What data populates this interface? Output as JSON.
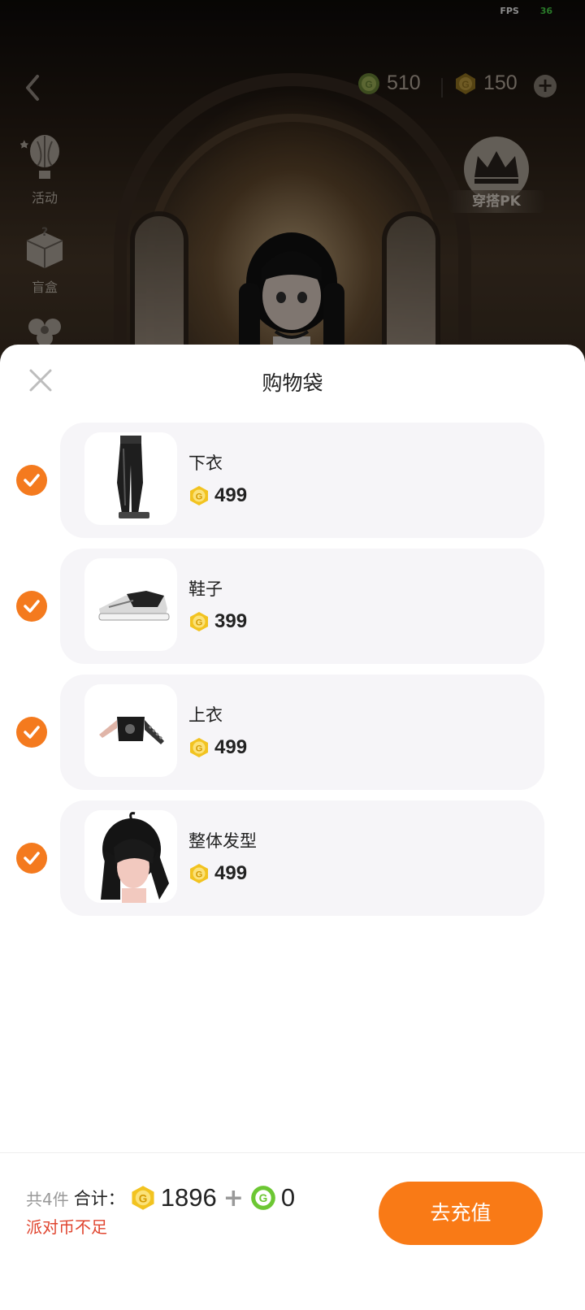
{
  "status_bar": {
    "fps_label": "FPS",
    "fps_value": "36"
  },
  "header": {
    "currency_green_value": "510",
    "currency_gold_value": "150"
  },
  "sidebar": {
    "items": [
      {
        "label": "活动",
        "icon": "hot-air-balloon-icon"
      },
      {
        "label": "盲盒",
        "icon": "mystery-box-icon"
      },
      {
        "label": "",
        "icon": "flower-icon"
      }
    ]
  },
  "pk_badge": {
    "label": "穿搭PK",
    "icon": "crown-icon"
  },
  "sheet": {
    "title": "购物袋",
    "items": [
      {
        "name": "下衣",
        "price": "499",
        "checked": true,
        "icon": "pants-icon"
      },
      {
        "name": "鞋子",
        "price": "399",
        "checked": true,
        "icon": "sneaker-icon"
      },
      {
        "name": "上衣",
        "price": "499",
        "checked": true,
        "icon": "top-icon"
      },
      {
        "name": "整体发型",
        "price": "499",
        "checked": true,
        "icon": "hairstyle-icon"
      }
    ]
  },
  "footer": {
    "count": "共4件",
    "total_label": "合计：",
    "gold_total": "1896",
    "plus": "+",
    "green_total": "0",
    "warning": "派对币不足",
    "recharge_label": "去充值"
  },
  "colors": {
    "accent": "#f97a16",
    "check": "#f47a1e",
    "warning": "#e0452f",
    "gold_coin": "#f2c320",
    "green_coin": "#6cc733"
  }
}
